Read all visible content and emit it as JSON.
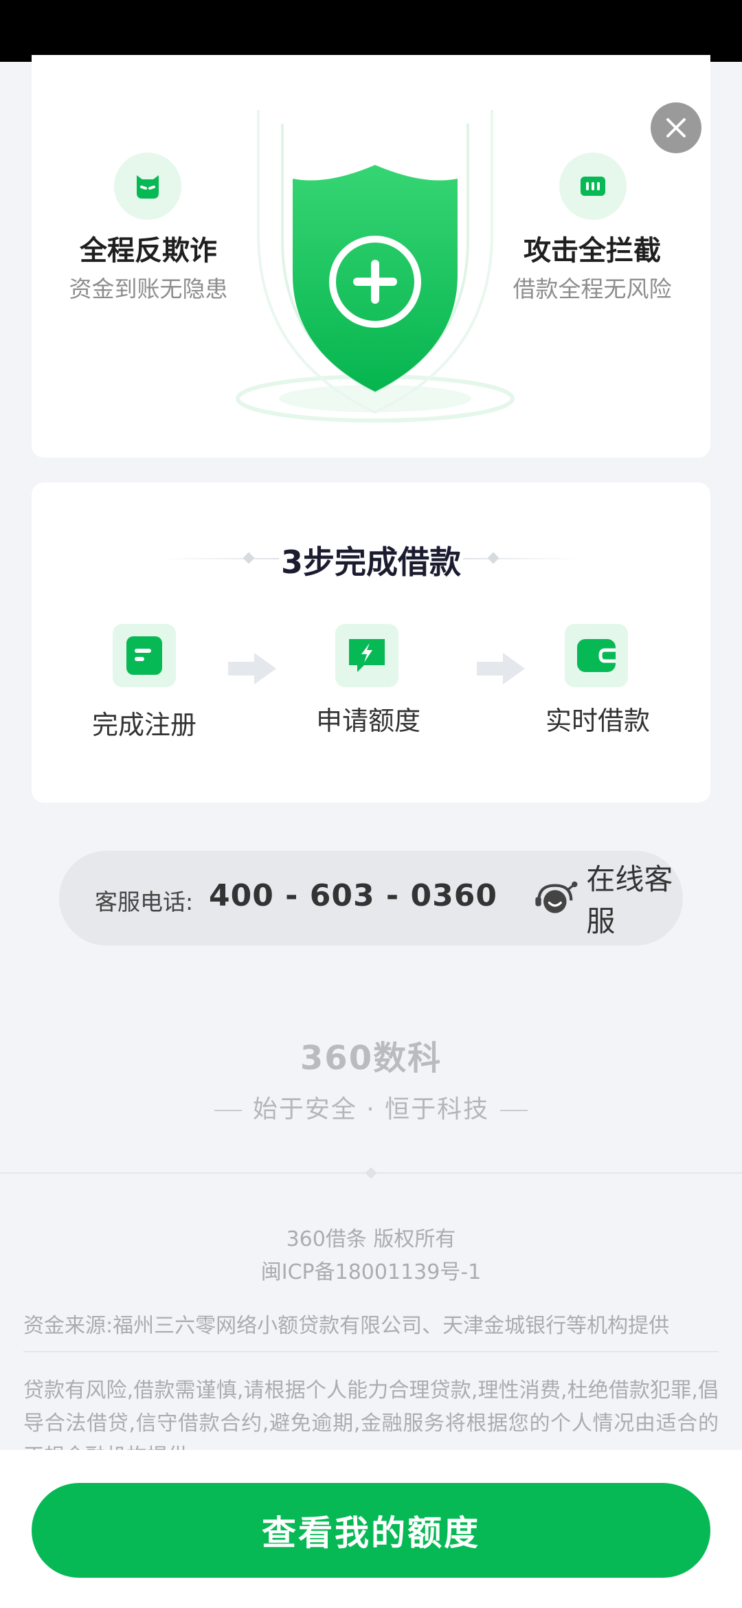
{
  "security": {
    "left_title": "全程反欺诈",
    "left_subtitle": "资金到账无隐患",
    "right_title": "攻击全拦截",
    "right_subtitle": "借款全程无风险",
    "close_icon": "close-icon"
  },
  "steps": {
    "title": "3步完成借款",
    "items": [
      {
        "label": "完成注册",
        "icon": "register-doc-icon"
      },
      {
        "label": "申请额度",
        "icon": "apply-lightning-icon"
      },
      {
        "label": "实时借款",
        "icon": "wallet-icon"
      }
    ]
  },
  "service": {
    "phone_label": "客服电话:",
    "phone_number": "400 - 603 - 0360",
    "online_label": "在线客服"
  },
  "brand": {
    "logo_text": "360数科",
    "slogan": "始于安全 · 恒于科技"
  },
  "footer": {
    "copyright": "360借条 版权所有",
    "icp": "闽ICP备18001139号-1",
    "source": "资金来源:福州三六零网络小额贷款有限公司、天津金城银行等机构提供",
    "risk": "贷款有风险,借款需谨慎,请根据个人能力合理贷款,理性消费,杜绝借款犯罪,倡导合法借贷,信守借款合约,避免逾期,金融服务将根据您的个人情况由适合的正规金融机构提供"
  },
  "cta": {
    "label": "查看我的额度"
  },
  "colors": {
    "primary": "#06b954",
    "light_green": "#e3f7ea",
    "background": "#f3f4f7"
  }
}
